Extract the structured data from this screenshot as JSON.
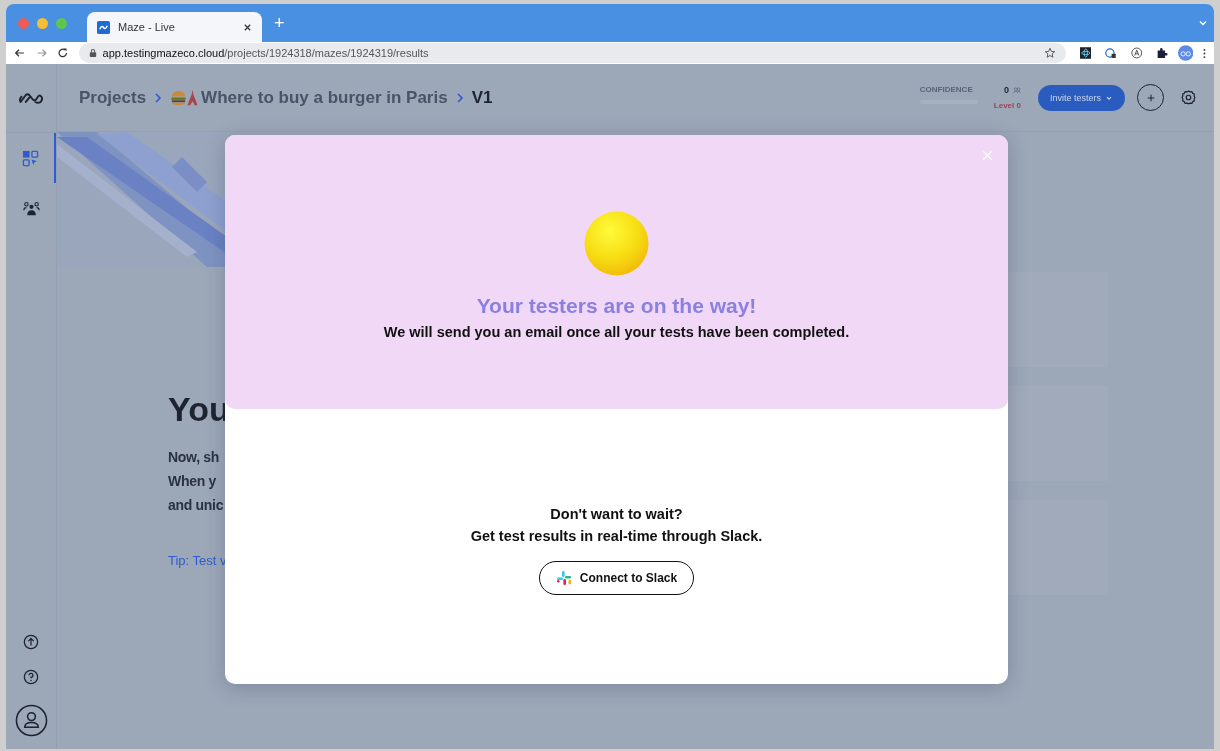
{
  "browser": {
    "tabs": [
      {
        "title": "Maze - Live",
        "selected": true
      }
    ],
    "new_tab": "+",
    "url_host": "app.testingmazeco.cloud",
    "url_path": "/projects/1924318/mazes/1924319/results"
  },
  "header": {
    "breadcrumb": [
      {
        "label": "Projects",
        "kind": "link"
      },
      {
        "label": "Where to buy a burger in Paris",
        "kind": "emoji-link"
      },
      {
        "label": "V1",
        "kind": "current"
      }
    ],
    "confidence": {
      "label": "CONFIDENCE",
      "count": "0",
      "level_text": "Level 0",
      "level": 0
    },
    "invite_button": "Invite testers"
  },
  "sidebar": {
    "items": [
      {
        "kind": "dashboard",
        "selected": true
      },
      {
        "kind": "team",
        "selected": false
      }
    ]
  },
  "background_content": {
    "heading": "You",
    "paragraph_lines": [
      "Now, sh",
      "When y",
      "and unic"
    ],
    "tip": "Tip: Test v"
  },
  "modal": {
    "title": "Your testers are on the way!",
    "subtitle": "We will send you an email once all your tests have been completed.",
    "prompt": "Don't want to wait?",
    "prompt_detail": "Get test results in real-time through Slack.",
    "button": "Connect to Slack"
  }
}
